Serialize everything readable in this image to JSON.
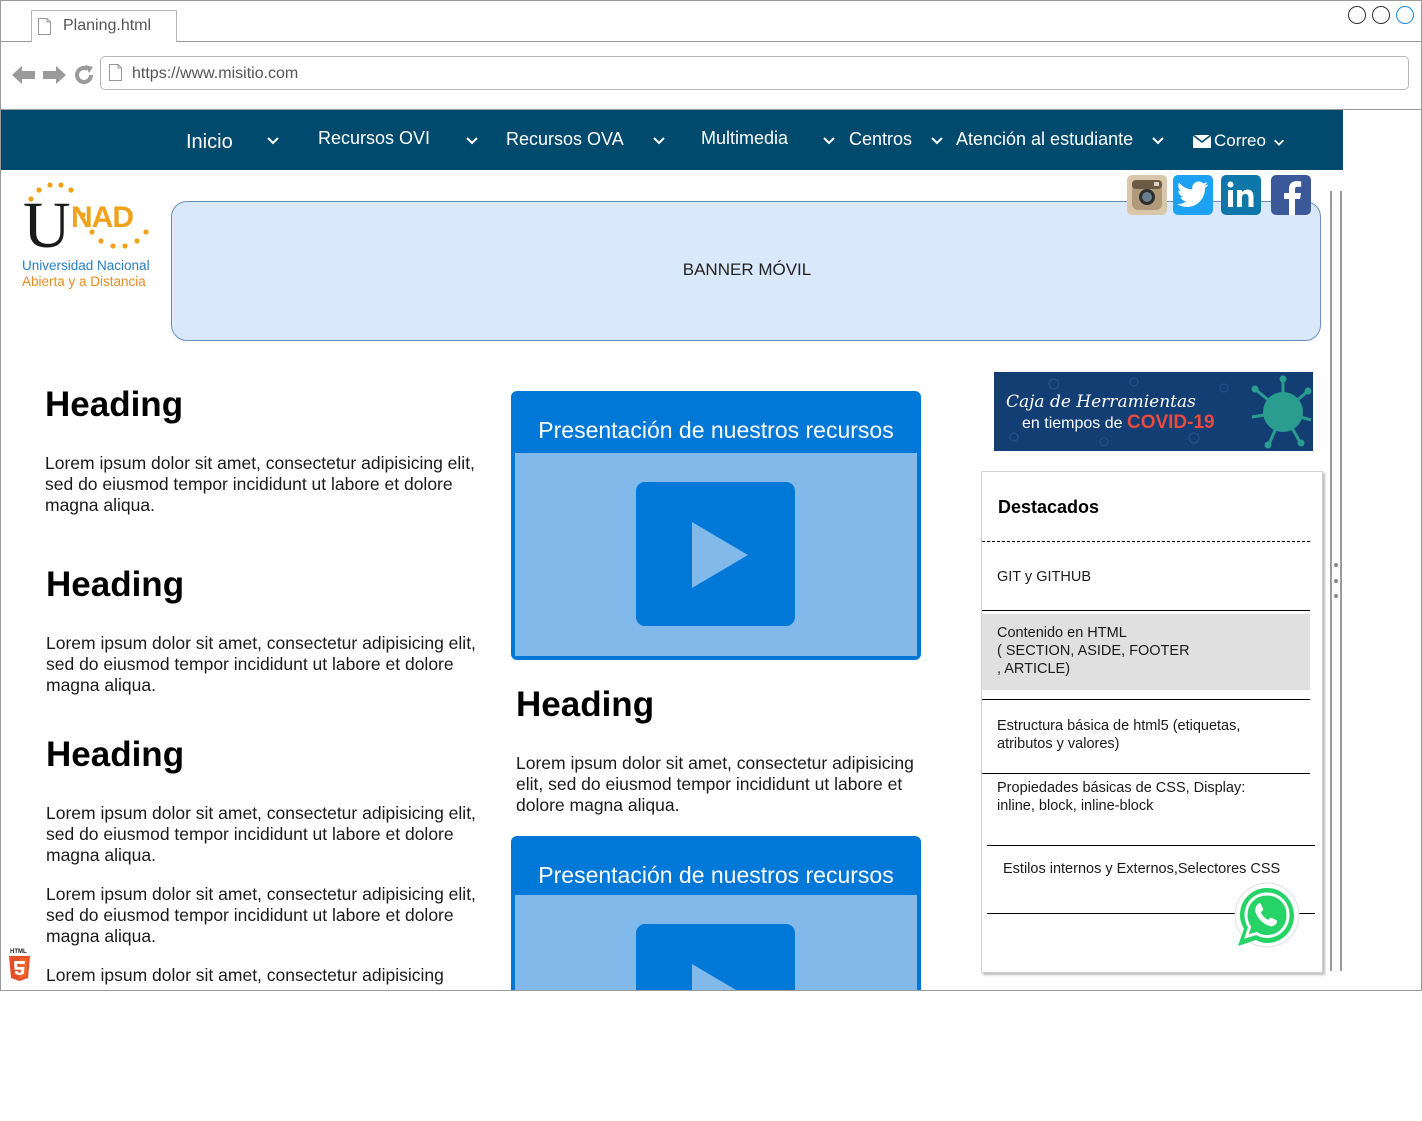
{
  "browser": {
    "tab_title": "Planing.html",
    "url": "https://www.misitio.com"
  },
  "nav": {
    "items": [
      {
        "label": "Inicio"
      },
      {
        "label": "Recursos OVI"
      },
      {
        "label": "Recursos OVA"
      },
      {
        "label": "Multimedia"
      },
      {
        "label": "Centros"
      },
      {
        "label": "Atención al estudiante"
      },
      {
        "label": "Correo"
      }
    ]
  },
  "logo": {
    "letter_u": "U",
    "letters_nad": "NAD",
    "line1": "Universidad Nacional",
    "line2": "Abierta y a Distancia"
  },
  "banner": {
    "text": "BANNER MÓVIL"
  },
  "social": [
    {
      "icon": "instagram-icon",
      "color": "#c9b59a"
    },
    {
      "icon": "twitter-icon",
      "color": "#1da1f2"
    },
    {
      "icon": "linkedin-icon",
      "color": "#0e76a8"
    },
    {
      "icon": "facebook-icon",
      "color": "#3b5998"
    }
  ],
  "left_column": {
    "sections": [
      {
        "heading": "Heading",
        "paragraphs": [
          "Lorem ipsum dolor sit amet, consectetur adipisicing elit, sed do eiusmod tempor incididunt ut labore et dolore magna aliqua."
        ]
      },
      {
        "heading": "Heading",
        "paragraphs": [
          "Lorem ipsum dolor sit amet, consectetur adipisicing elit, sed do eiusmod tempor incididunt ut labore et dolore magna aliqua."
        ]
      },
      {
        "heading": "Heading",
        "paragraphs": [
          "Lorem ipsum dolor sit amet, consectetur adipisicing elit, sed do eiusmod tempor incididunt ut labore et dolore magna aliqua.",
          "Lorem ipsum dolor sit amet, consectetur adipisicing elit, sed do eiusmod tempor incididunt ut labore et dolore magna aliqua.",
          "Lorem ipsum dolor sit amet, consectetur adipisicing"
        ]
      }
    ]
  },
  "center_column": {
    "video_title": "Presentación de nuestros recursos",
    "heading": "Heading",
    "paragraph": "Lorem ipsum dolor sit amet, consectetur adipisicing elit, sed do eiusmod tempor incididunt ut labore et dolore magna aliqua.",
    "video_title_2": "Presentación de nuestros recursos"
  },
  "covid_banner": {
    "line1": "Caja de Herramientas",
    "line2": "en tiempos de",
    "line3": "COVID-19"
  },
  "destacados": {
    "title": "Destacados",
    "items": [
      {
        "lines": [
          "GIT y GITHUB"
        ]
      },
      {
        "lines": [
          "Contenido en HTML",
          "( SECTION, ASIDE, FOOTER",
          ", ARTICLE)"
        ]
      },
      {
        "lines": [
          "Estructura básica de html5 (etiquetas,",
          "atributos y valores)"
        ]
      },
      {
        "lines": [
          "Propiedades básicas de CSS, Display:",
          "inline, block, inline-block"
        ]
      },
      {
        "lines": [
          "Estilos internos y Externos,Selectores CSS"
        ]
      }
    ]
  },
  "html5_badge": "HTML",
  "colors": {
    "nav_bg": "#004a6e",
    "banner_bg": "#dae8fc",
    "video_blue": "#0078d7",
    "video_light": "#81b9ea",
    "whatsapp": "#25d366"
  }
}
